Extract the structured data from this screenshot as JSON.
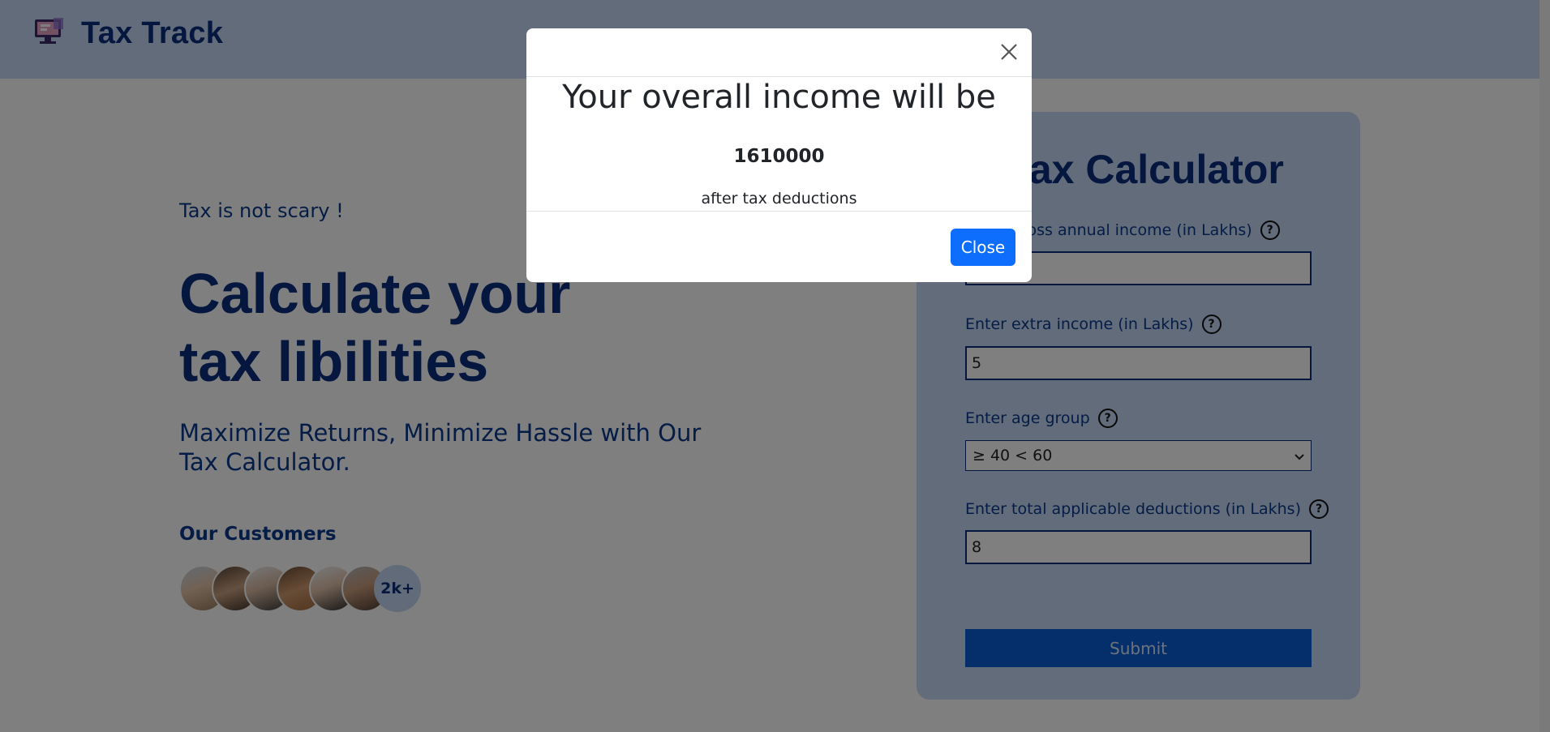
{
  "header": {
    "brand": "Tax Track",
    "logo_icon": "computer-tax-logo-icon"
  },
  "hero": {
    "tagline": "Tax is not scary !",
    "headline_line1": "Calculate your",
    "headline_line2": "tax libilities",
    "subhead": "Maximize Returns, Minimize Hassle with Our Tax Calculator.",
    "customers_title": "Our Customers",
    "customers_count": "2k+"
  },
  "calculator": {
    "title": "Tax Calculator",
    "fields": [
      {
        "label": "Enter gross annual income (in Lakhs)",
        "value": ""
      },
      {
        "label": "Enter extra income (in Lakhs)",
        "value": "5"
      },
      {
        "label": "Enter age group",
        "value": "≥ 40 < 60"
      },
      {
        "label": "Enter total applicable deductions (in Lakhs)",
        "value": "8"
      }
    ],
    "help_icon": "question-circle-icon",
    "submit_label": "Submit"
  },
  "modal": {
    "title": "Your overall income will be",
    "amount": "1610000",
    "note": "after tax deductions",
    "close_label": "Close",
    "close_icon": "close-icon"
  },
  "colors": {
    "brand_navy": "#0a2f7e",
    "panel_blue": "#c5d8f5",
    "primary_button": "#0d6efd",
    "submit_button": "#0b5ed7"
  }
}
